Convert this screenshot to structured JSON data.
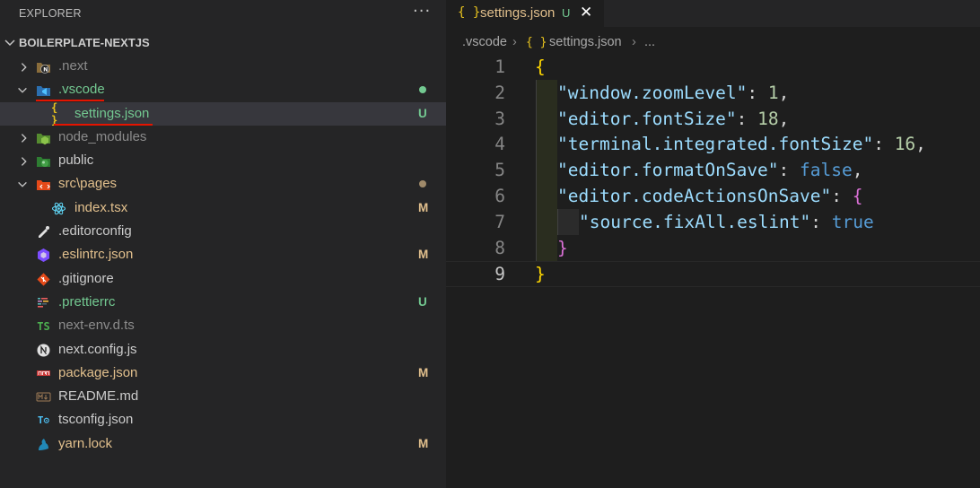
{
  "sidebar": {
    "title": "EXPLORER",
    "more": "···",
    "project": "BOILERPLATE-NEXTJS",
    "items": [
      {
        "label": ".next",
        "status": "",
        "icon": "nextjs-folder-icon"
      },
      {
        "label": ".vscode",
        "status": "dot",
        "icon": "vscode-folder-icon"
      },
      {
        "label": "settings.json",
        "status": "U",
        "icon": "json-braces-icon"
      },
      {
        "label": "node_modules",
        "status": "",
        "icon": "node-modules-folder-icon"
      },
      {
        "label": "public",
        "status": "",
        "icon": "public-folder-icon"
      },
      {
        "label": "src\\pages",
        "status": "dot",
        "icon": "src-folder-icon"
      },
      {
        "label": "index.tsx",
        "status": "M",
        "icon": "react-icon"
      },
      {
        "label": ".editorconfig",
        "status": "",
        "icon": "editorconfig-icon"
      },
      {
        "label": ".eslintrc.json",
        "status": "M",
        "icon": "eslint-icon"
      },
      {
        "label": ".gitignore",
        "status": "",
        "icon": "git-icon"
      },
      {
        "label": ".prettierrc",
        "status": "U",
        "icon": "prettier-icon"
      },
      {
        "label": "next-env.d.ts",
        "status": "",
        "icon": "typescript-icon"
      },
      {
        "label": "next.config.js",
        "status": "",
        "icon": "nextjs-icon"
      },
      {
        "label": "package.json",
        "status": "M",
        "icon": "npm-icon"
      },
      {
        "label": "README.md",
        "status": "",
        "icon": "markdown-icon"
      },
      {
        "label": "tsconfig.json",
        "status": "",
        "icon": "tsconfig-icon"
      },
      {
        "label": "yarn.lock",
        "status": "M",
        "icon": "yarn-icon"
      }
    ]
  },
  "editor": {
    "tab": {
      "icon": "{ }",
      "label": "settings.json",
      "status": "U",
      "close": "✕"
    },
    "breadcrumb": [
      ".vscode",
      "{ }",
      "settings.json",
      "..."
    ],
    "lines": [
      {
        "n": "1",
        "text": "{"
      },
      {
        "n": "2",
        "text": "\"window.zoomLevel\": 1,"
      },
      {
        "n": "3",
        "text": "\"editor.fontSize\": 18,"
      },
      {
        "n": "4",
        "text": "\"terminal.integrated.fontSize\": 16,"
      },
      {
        "n": "5",
        "text": "\"editor.formatOnSave\": false,"
      },
      {
        "n": "6",
        "text": "\"editor.codeActionsOnSave\": {"
      },
      {
        "n": "7",
        "text": "\"source.fixAll.eslint\": true"
      },
      {
        "n": "8",
        "text": "}"
      },
      {
        "n": "9",
        "text": "}"
      }
    ]
  },
  "colors": {
    "sidebar_bg": "#252526",
    "editor_bg": "#1e1e1e",
    "modified": "#e2c08d",
    "untracked": "#73c991",
    "ignored": "#8c8c8c",
    "json_key": "#9cdcfe",
    "json_number": "#b5cea8",
    "json_keyword": "#569cd6",
    "bracket_gold": "#ffd700",
    "bracket_purple": "#da70d6",
    "annotation_underline": "#e51400"
  }
}
